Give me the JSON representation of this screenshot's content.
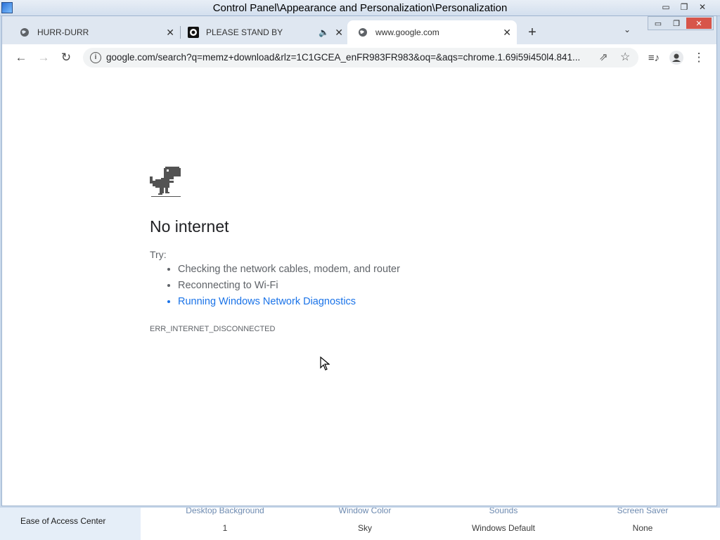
{
  "control_panel": {
    "title": "Control Panel\\Appearance and Personalization\\Personalization",
    "sidebar_link": "Ease of Access Center",
    "theme_items": [
      {
        "label": "Desktop Background",
        "value": "1"
      },
      {
        "label": "Window Color",
        "value": "Sky"
      },
      {
        "label": "Sounds",
        "value": "Windows Default"
      },
      {
        "label": "Screen Saver",
        "value": "None"
      }
    ]
  },
  "browser": {
    "tabs": [
      {
        "title": "HURR-DURR",
        "icon": "globe-icon"
      },
      {
        "title": "PLEASE STAND BY",
        "icon": "youtube-style-icon",
        "audio": true
      },
      {
        "title": "www.google.com",
        "icon": "globe-icon",
        "active": true
      }
    ],
    "url": "google.com/search?q=memz+download&rlz=1C1GCEA_enFR983FR983&oq=&aqs=chrome.1.69i59i450l4.841..."
  },
  "error_page": {
    "title": "No internet",
    "try_label": "Try:",
    "suggestions": [
      "Checking the network cables, modem, and router",
      "Reconnecting to Wi-Fi",
      "Running Windows Network Diagnostics"
    ],
    "error_code": "ERR_INTERNET_DISCONNECTED"
  },
  "colors": {
    "link": "#1a73e8",
    "text": "#202124",
    "secondary_text": "#5f6368"
  }
}
